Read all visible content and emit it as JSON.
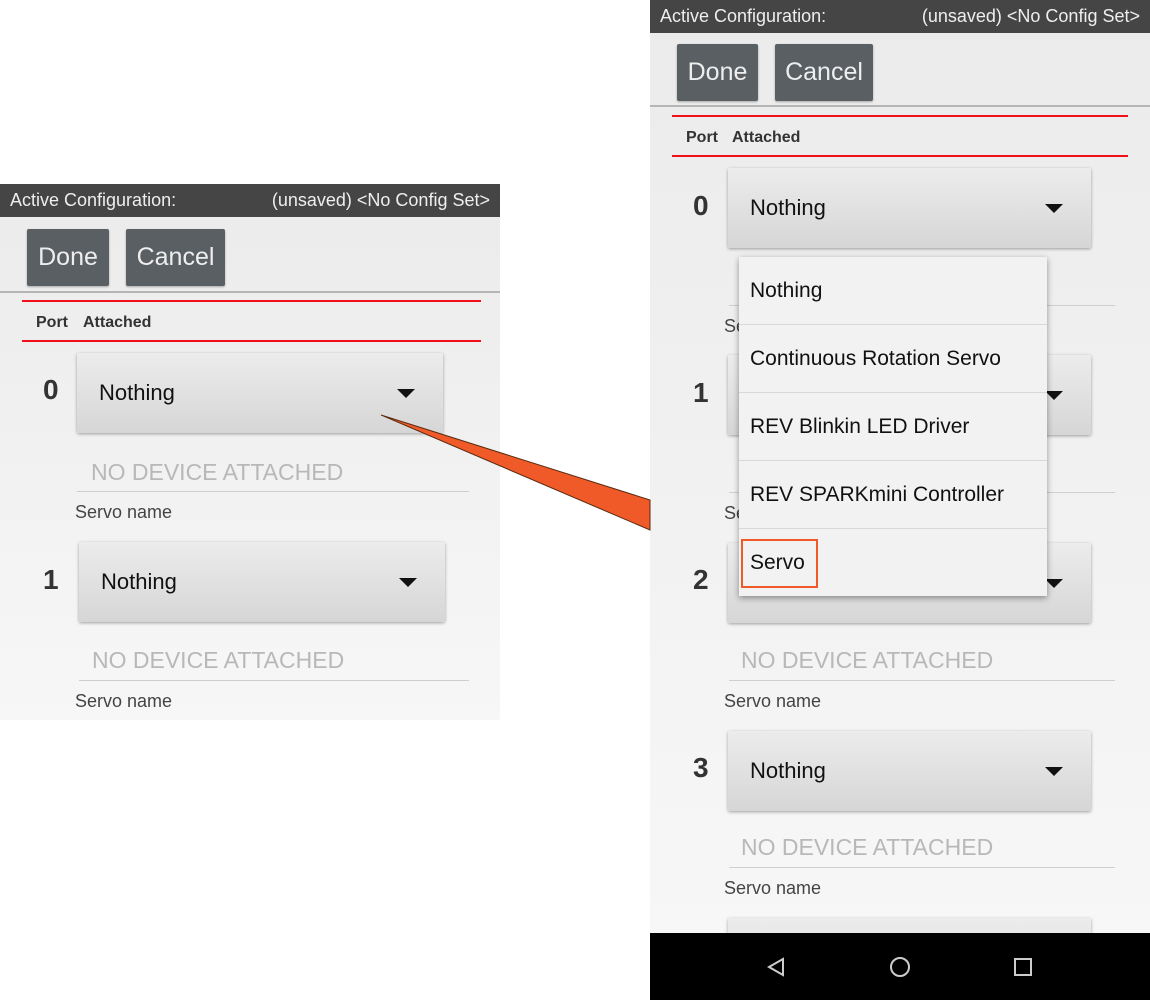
{
  "header": {
    "label": "Active Configuration:",
    "value": "(unsaved) <No Config Set>"
  },
  "buttons": {
    "done": "Done",
    "cancel": "Cancel"
  },
  "columns": {
    "port": "Port",
    "attached": "Attached"
  },
  "left_ports": [
    {
      "port": "0",
      "device": "Nothing",
      "name_placeholder": "NO DEVICE ATTACHED",
      "name_label": "Servo name"
    },
    {
      "port": "1",
      "device": "Nothing",
      "name_placeholder": "NO DEVICE ATTACHED",
      "name_label": "Servo name"
    }
  ],
  "right_ports": [
    {
      "port": "0",
      "device": "Nothing"
    },
    {
      "port": "1"
    },
    {
      "port": "2",
      "name_placeholder": "NO DEVICE ATTACHED",
      "name_label": "Servo name"
    },
    {
      "port": "3",
      "device": "Nothing",
      "name_placeholder": "NO DEVICE ATTACHED",
      "name_label": "Servo name"
    }
  ],
  "dropdown_options": [
    "Nothing",
    "Continuous Rotation Servo",
    "REV Blinkin LED Driver",
    "REV SPARKmini Controller",
    "Servo"
  ],
  "highlighted_option": "Servo",
  "colors": {
    "header": "#454545",
    "button": "#5a5f63",
    "red_rule": "#f0101a",
    "callout": "#f05a28"
  },
  "nav_icons": [
    "back-icon",
    "home-icon",
    "recents-icon"
  ]
}
